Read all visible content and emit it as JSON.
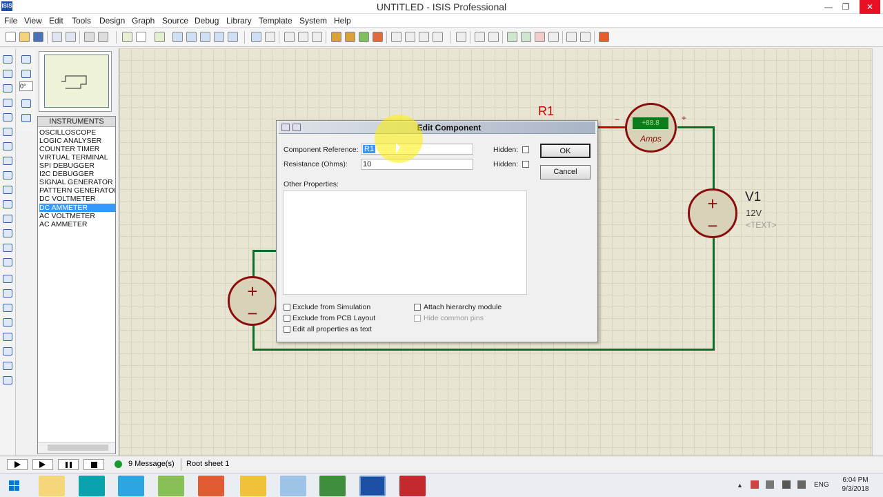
{
  "window": {
    "title": "UNTITLED - ISIS Professional",
    "app_icon": "ISIS"
  },
  "menu": [
    "File",
    "View",
    "Edit",
    "Tools",
    "Design",
    "Graph",
    "Source",
    "Debug",
    "Library",
    "Template",
    "System",
    "Help"
  ],
  "instruments": {
    "header": "INSTRUMENTS",
    "items": [
      "OSCILLOSCOPE",
      "LOGIC ANALYSER",
      "COUNTER TIMER",
      "VIRTUAL TERMINAL",
      "SPI DEBUGGER",
      "I2C DEBUGGER",
      "SIGNAL GENERATOR",
      "PATTERN GENERATOR",
      "DC VOLTMETER",
      "DC AMMETER",
      "AC VOLTMETER",
      "AC AMMETER"
    ],
    "selected_index": 9
  },
  "rotation": "0°",
  "schematic": {
    "r1_label": "R1",
    "v1_label": "V1",
    "v1_value": "12V",
    "v1_text": "<TEXT>",
    "ammeter_label": "Amps",
    "ammeter_display": "+88.8",
    "ammeter_minus": "−",
    "ammeter_plus": "+",
    "battery_plus": "+",
    "battery_minus": "−"
  },
  "dialog": {
    "title": "Edit Component",
    "component_reference_label": "Component Reference:",
    "component_reference_value": "R1",
    "resistance_label": "Resistance (Ohms):",
    "resistance_value": "10",
    "hidden_label": "Hidden:",
    "other_properties_label": "Other Properties:",
    "ok_label": "OK",
    "cancel_label": "Cancel",
    "exclude_simulation": "Exclude from Simulation",
    "exclude_pcb": "Exclude from PCB Layout",
    "edit_all_text": "Edit all properties as text",
    "attach_hierarchy": "Attach hierarchy module",
    "hide_common_pins": "Hide common pins"
  },
  "status": {
    "messages": "9 Message(s)",
    "sheet": "Root sheet 1"
  },
  "taskbar": {
    "lang": "ENG",
    "time": "6:04 PM",
    "date": "9/3/2018"
  },
  "colors": {
    "wire": "#0a6e2a",
    "component_red": "#8b0d0d",
    "canvas": "#e8e6d2",
    "selection": "#3399ff"
  }
}
